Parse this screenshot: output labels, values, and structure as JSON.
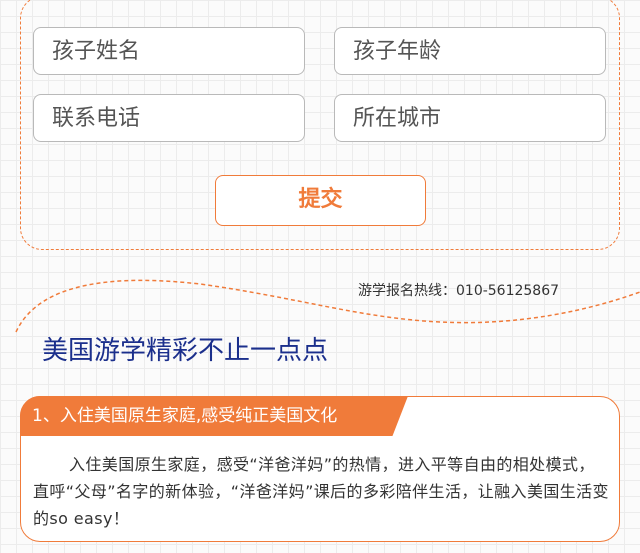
{
  "form": {
    "child_name_placeholder": "孩子姓名",
    "child_age_placeholder": "孩子年龄",
    "phone_placeholder": "联系电话",
    "city_placeholder": "所在城市",
    "submit_label": "提交"
  },
  "hotline": {
    "text": "游学报名热线：010-56125867"
  },
  "section": {
    "title": "美国游学精彩不止一点点"
  },
  "feature": {
    "tag": "1、入住美国原生家庭,感受纯正美国文化",
    "body": "入住美国原生家庭，感受“洋爸洋妈”的热情，进入平等自由的相处模式，直呼“父母”名字的新体验，“洋爸洋妈”课后的多彩陪伴生活，让融入美国生活变的so easy！"
  },
  "colors": {
    "accent": "#f07b3a",
    "title_blue": "#1b2f8c"
  }
}
